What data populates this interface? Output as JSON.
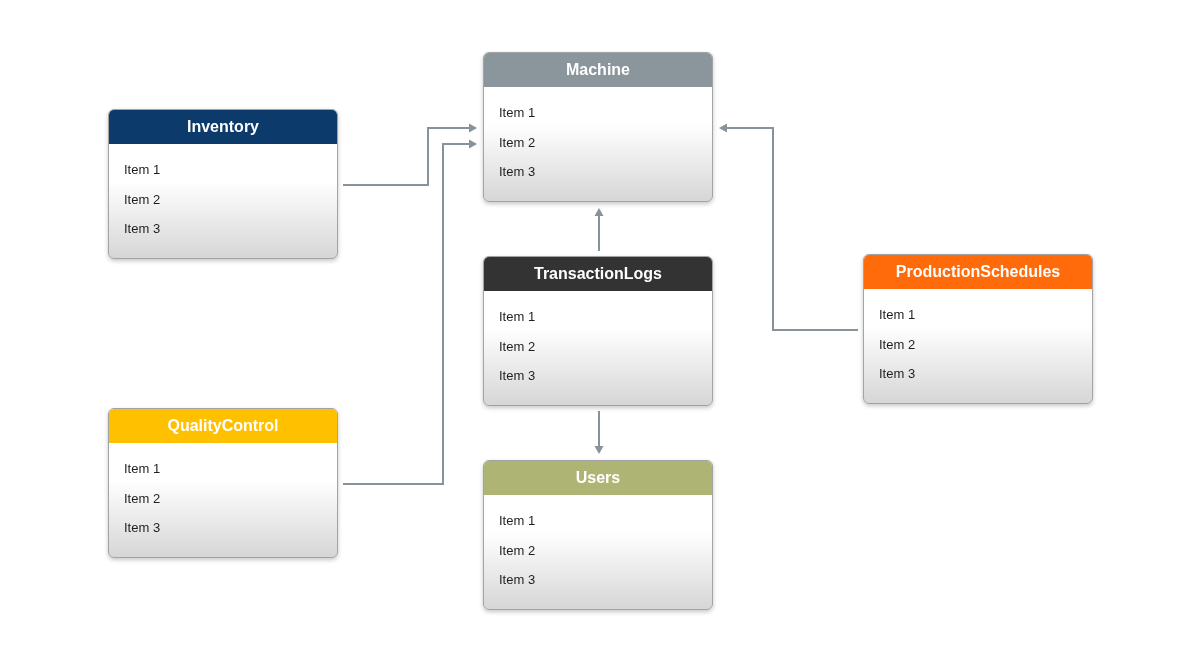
{
  "diagram": {
    "title": "Machine",
    "color": "#8a969c",
    "items": [
      "Item 1",
      "Item 2",
      "Item 3"
    ],
    "incoming": [
      {
        "title": "Inventory",
        "color": "#0b3a6b",
        "items": [
          "Item 1",
          "Item 2",
          "Item 3"
        ]
      },
      {
        "title": "QualityControl",
        "color": "#ffc000",
        "items": [
          "Item 1",
          "Item 2",
          "Item 3"
        ]
      },
      {
        "title": "TransactionLogs",
        "color": "#333333",
        "items": [
          "Item 1",
          "Item 2",
          "Item 3"
        ],
        "outgoing": [
          {
            "title": "Users",
            "color": "#aeb574",
            "items": [
              "Item 1",
              "Item 2",
              "Item 3"
            ]
          }
        ]
      },
      {
        "title": "ProductionSchedules",
        "color": "#ff6b0a",
        "items": [
          "Item 1",
          "Item 2",
          "Item 3"
        ]
      }
    ]
  }
}
